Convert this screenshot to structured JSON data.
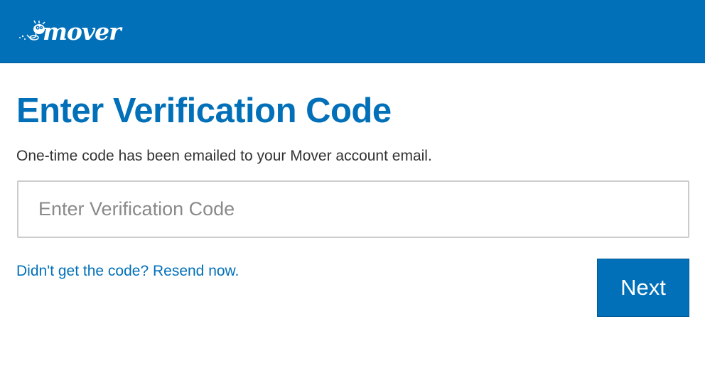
{
  "header": {
    "logo_text": "mover",
    "logo_icon": "mover-mascot-icon",
    "background_color": "#0170b9"
  },
  "main": {
    "title": "Enter Verification Code",
    "subtitle": "One-time code has been emailed to your Mover account email.",
    "code_input": {
      "value": "",
      "placeholder": "Enter Verification Code"
    },
    "resend_link": "Didn't get the code? Resend now.",
    "next_button": "Next"
  },
  "colors": {
    "brand_blue": "#0170b9",
    "text_dark": "#333333",
    "placeholder_gray": "#8a8a8a",
    "border_gray": "#cccccc"
  }
}
